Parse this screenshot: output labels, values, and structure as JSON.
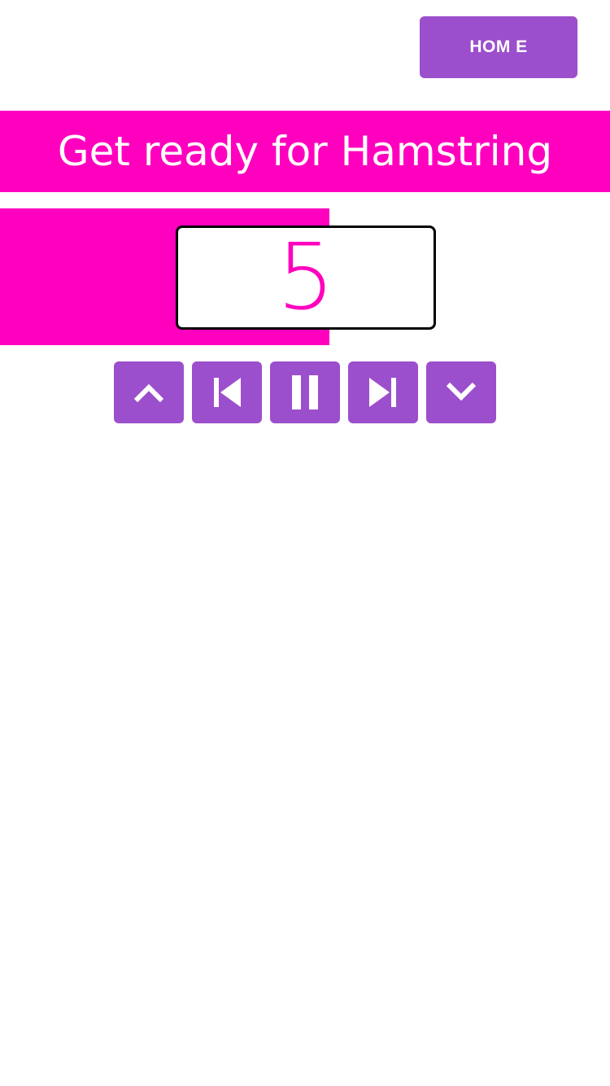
{
  "header": {
    "home_label": "HOM E"
  },
  "banner": {
    "text": "Get ready for Hamstring"
  },
  "countdown": {
    "value": "5",
    "progress_fraction": 0.54
  },
  "controls": [
    {
      "name": "up-button",
      "icon": "chevron-up-icon"
    },
    {
      "name": "previous-button",
      "icon": "skip-previous-icon"
    },
    {
      "name": "pause-button",
      "icon": "pause-icon"
    },
    {
      "name": "next-button",
      "icon": "skip-next-icon"
    },
    {
      "name": "down-button",
      "icon": "chevron-down-icon"
    }
  ],
  "colors": {
    "accent": "#9c4fcc",
    "highlight": "#ff00bf",
    "text_on_accent": "#ffffff"
  }
}
